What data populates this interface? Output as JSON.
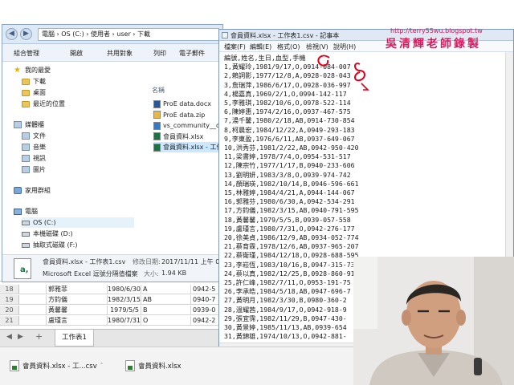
{
  "overlay": {
    "blog_url": "http://terry55wu.blogspot.tw",
    "watermark": "吳清輝老師錄製"
  },
  "explorer": {
    "address": "電腦 › OS (C:) › 使用者 › user › 下載",
    "toolbar": [
      "組合管理",
      "開啟",
      "共用對象",
      "列印",
      "電子郵件"
    ],
    "nav": {
      "favorites": "我的最愛",
      "favorites_items": [
        "下載",
        "桌面",
        "最近的位置"
      ],
      "libraries": "媒體櫃",
      "libraries_items": [
        "文件",
        "音樂",
        "視訊",
        "圖片"
      ],
      "homegroup": "家用群組",
      "computer": "電腦",
      "computer_items": [
        "OS (C:)",
        "本機磁碟 (D:)",
        "抽取式磁碟 (F:)"
      ]
    },
    "column_header": "名稱",
    "files": [
      {
        "name": "ProE data.docx",
        "icon": "word-icon"
      },
      {
        "name": "ProE data.zip",
        "icon": "zip-icon"
      },
      {
        "name": "vs_community__dh...",
        "icon": "installer-icon"
      },
      {
        "name": "會員資料.xlsx",
        "icon": "excel-icon"
      },
      {
        "name": "會員資料.xlsx - 工作...",
        "icon": "excel-csv-icon"
      }
    ],
    "details": {
      "name": "會員資料.xlsx - 工作表1.csv",
      "type": "Microsoft Excel 逗號分隔值檔案",
      "modified_label": "修改日期:",
      "modified": "2017/11/11 上午 09",
      "size_label": "大小:",
      "size": "1.94 KB"
    }
  },
  "excel": {
    "rows": [
      {
        "n": "18",
        "name": "郭雅菲",
        "date": "1980/6/30",
        "blood": "A",
        "phone": "0942-5"
      },
      {
        "n": "19",
        "name": "方鈞儀",
        "date": "1982/3/15",
        "blood": "AB",
        "phone": "0940-7"
      },
      {
        "n": "20",
        "name": "黃馨馨",
        "date": "1979/5/5",
        "blood": "B",
        "phone": "0939-0"
      },
      {
        "n": "21",
        "name": "盧瑾言",
        "date": "1980/7/31",
        "blood": "O",
        "phone": "0942-2"
      }
    ],
    "sheet_tab": "工作表1",
    "nav_prev": "◀",
    "nav_next": "▶",
    "add_sheet": "+"
  },
  "notepad": {
    "title": "會員資料.xlsx - 工作表1.csv - 記事本",
    "menus": [
      "檔案(F)",
      "編輯(E)",
      "格式(O)",
      "檢視(V)",
      "說明(H)"
    ],
    "lines": [
      "編號,姓名,生日,血型,手機",
      "1,黃耀玲,1981/9/17,O,0914-084-007",
      "2,賴詞影,1977/12/8,A,0928-028-043",
      "3,詹瑞萍,1986/6/17,O,0928-036-997",
      "4,楊嘉真,1969/2/1,O,0994-142-117",
      "5,李雅琪,1982/10/6,O,0978-522-114",
      "6,陳婷惠,1974/2/16,O,0937-467-575",
      "7,湯千馨,1980/2/18,AB,0914-730-854",
      "8,柯晨宏,1984/12/22,A,0949-293-183",
      "9,李東盈,1976/6/11,AB,0937-649-067",
      "10,洪秀芬,1981/2/22,AB,0942-950-420",
      "11,梁書婷,1978/7/4,O,0954-531-517",
      "12,陳宗竹,1977/1/17,B,0940-233-606",
      "13,劉明妍,1983/3/8,O,0939-974-742",
      "14,顏瑞瑛,1982/10/14,B,0946-596-661",
      "15,林雅婷,1984/4/21,A,0944-144-067",
      "16,郭雅芬,1980/6/30,A,0942-534-291",
      "17,方鈞儀,1982/3/15,AB,0940-791-595",
      "18,黃馨馨,1979/5/5,B,0939-057-558",
      "19,盧瑾言,1980/7/31,O,0942-276-177",
      "20,徐美貞,1986/12/9,AB,0934-052-774",
      "21,蔡育霖,1978/12/6,AB,0937-965-207",
      "22,蔡衛瑾,1984/12/18,O,0928-688-595",
      "23,李崧恆,1983/10/16,B,0947-315-736",
      "24,蔡以真,1982/12/25,B,0928-860-911",
      "25,許仁峰,1982/7/11,O,0953-191-75",
      "26,李承皓,1984/5/18,AB,0947-696-7",
      "27,黃明月,1982/3/30,B,0980-360-2",
      "28,溫耀茜,1984/9/17,O,0942-918-9",
      "29,張宜霈,1982/11/29,B,0947-430-",
      "30,黃景婷,1985/11/13,AB,0939-654",
      "31,黃錦雄,1974/10/13,O,0942-881-",
      "32,劉政弈,1977/7/10,A,0942-565-"
    ]
  },
  "taskbar": [
    {
      "label": "會員資料.xlsx - 工...csv",
      "icon": "excel-icon"
    },
    {
      "label": "會員資料.xlsx",
      "icon": "excel-icon"
    }
  ],
  "colors": {
    "annotation": "#e0001b",
    "watermark": "#d81b60",
    "selection": "#cce8ff"
  }
}
